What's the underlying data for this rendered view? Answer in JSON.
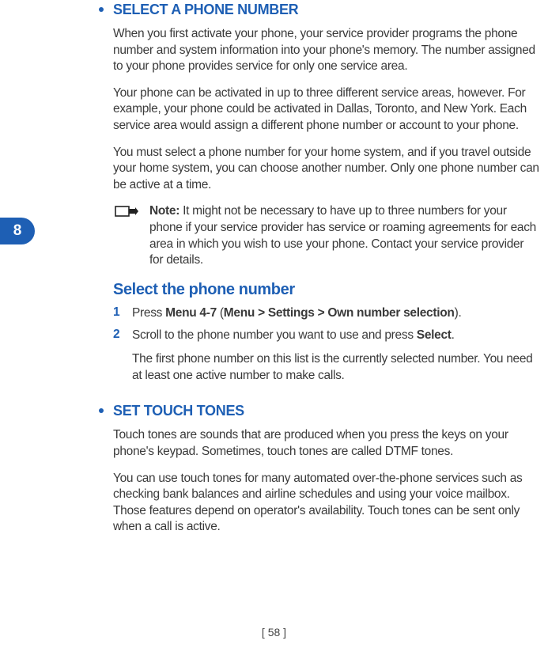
{
  "chapter": "8",
  "section1": {
    "heading": "SELECT A PHONE NUMBER",
    "p1": "When you first activate your phone, your service provider programs the phone number and system information into your phone's memory. The number assigned to your phone provides service for only one service area.",
    "p2": "Your phone can be activated in up to three different service areas, however. For example, your phone could be activated in Dallas, Toronto, and New York. Each service area would assign a different phone number or account to your phone.",
    "p3": "You must select a phone number for your home system, and if you travel outside your home system, you can choose another number. Only one phone number can be active at a time.",
    "note_label": "Note:",
    "note_text": "  It might not be necessary to have up to three numbers for your phone if your service provider has service or roaming agreements for each area in which you wish to use your phone. Contact your service provider for details.",
    "subheading": "Select the phone number",
    "step1_num": "1",
    "step1_a": "Press ",
    "step1_b": "Menu 4-7",
    "step1_c": " (",
    "step1_d": "Menu > Settings > Own number selection",
    "step1_e": ").",
    "step2_num": "2",
    "step2_a": "Scroll to the phone number you want to use and press ",
    "step2_b": "Select",
    "step2_c": ".",
    "step_follow": "The first phone number on this list is the currently selected number. You need at least one active number to make calls."
  },
  "section2": {
    "heading": "SET TOUCH TONES",
    "p1": "Touch tones are sounds that are produced when you press the keys on your phone's keypad. Sometimes, touch tones are called DTMF tones.",
    "p2": "You can use touch tones for many automated over-the-phone services such as checking bank balances and airline schedules and using your voice mailbox. Those features depend on operator's availability. Touch tones can be sent only when a call is active."
  },
  "page_number": "[ 58 ]"
}
